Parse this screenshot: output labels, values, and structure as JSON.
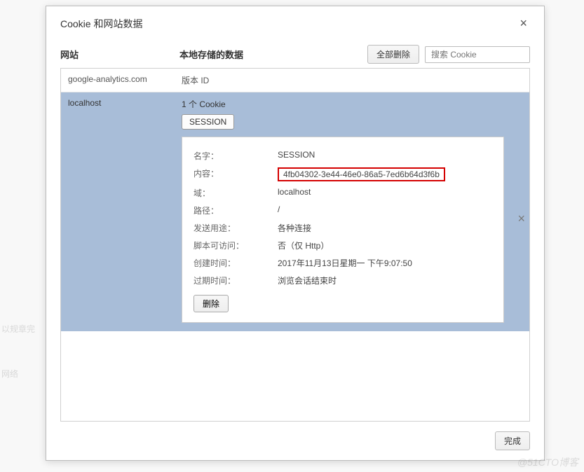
{
  "dialog": {
    "title": "Cookie 和网站数据",
    "close_label": "×"
  },
  "columns": {
    "site": "网站",
    "data": "本地存储的数据"
  },
  "actions": {
    "delete_all": "全部删除",
    "search_placeholder": "搜索 Cookie",
    "done": "完成",
    "delete": "删除",
    "row_delete": "×"
  },
  "sites": [
    {
      "name": "google-analytics.com",
      "summary": "版本 ID"
    }
  ],
  "selected": {
    "name": "localhost",
    "summary": "1 个 Cookie",
    "cookie_chip": "SESSION",
    "details": {
      "name_label": "名字：",
      "name_value": "SESSION",
      "content_label": "内容：",
      "content_value": "4fb04302-3e44-46e0-86a5-7ed6b64d3f6b",
      "domain_label": "域：",
      "domain_value": "localhost",
      "path_label": "路径：",
      "path_value": "/",
      "send_label": "发送用途：",
      "send_value": "各种连接",
      "script_label": "脚本可访问：",
      "script_value": "否（仅 Http）",
      "created_label": "创建时间：",
      "created_value": "2017年11月13日星期一 下午9:07:50",
      "expires_label": "过期时间：",
      "expires_value": "浏览会话结束时"
    }
  },
  "watermark": "@51CTO博客",
  "bg_hints": {
    "hint1": "以规章完",
    "hint2": "网络"
  }
}
